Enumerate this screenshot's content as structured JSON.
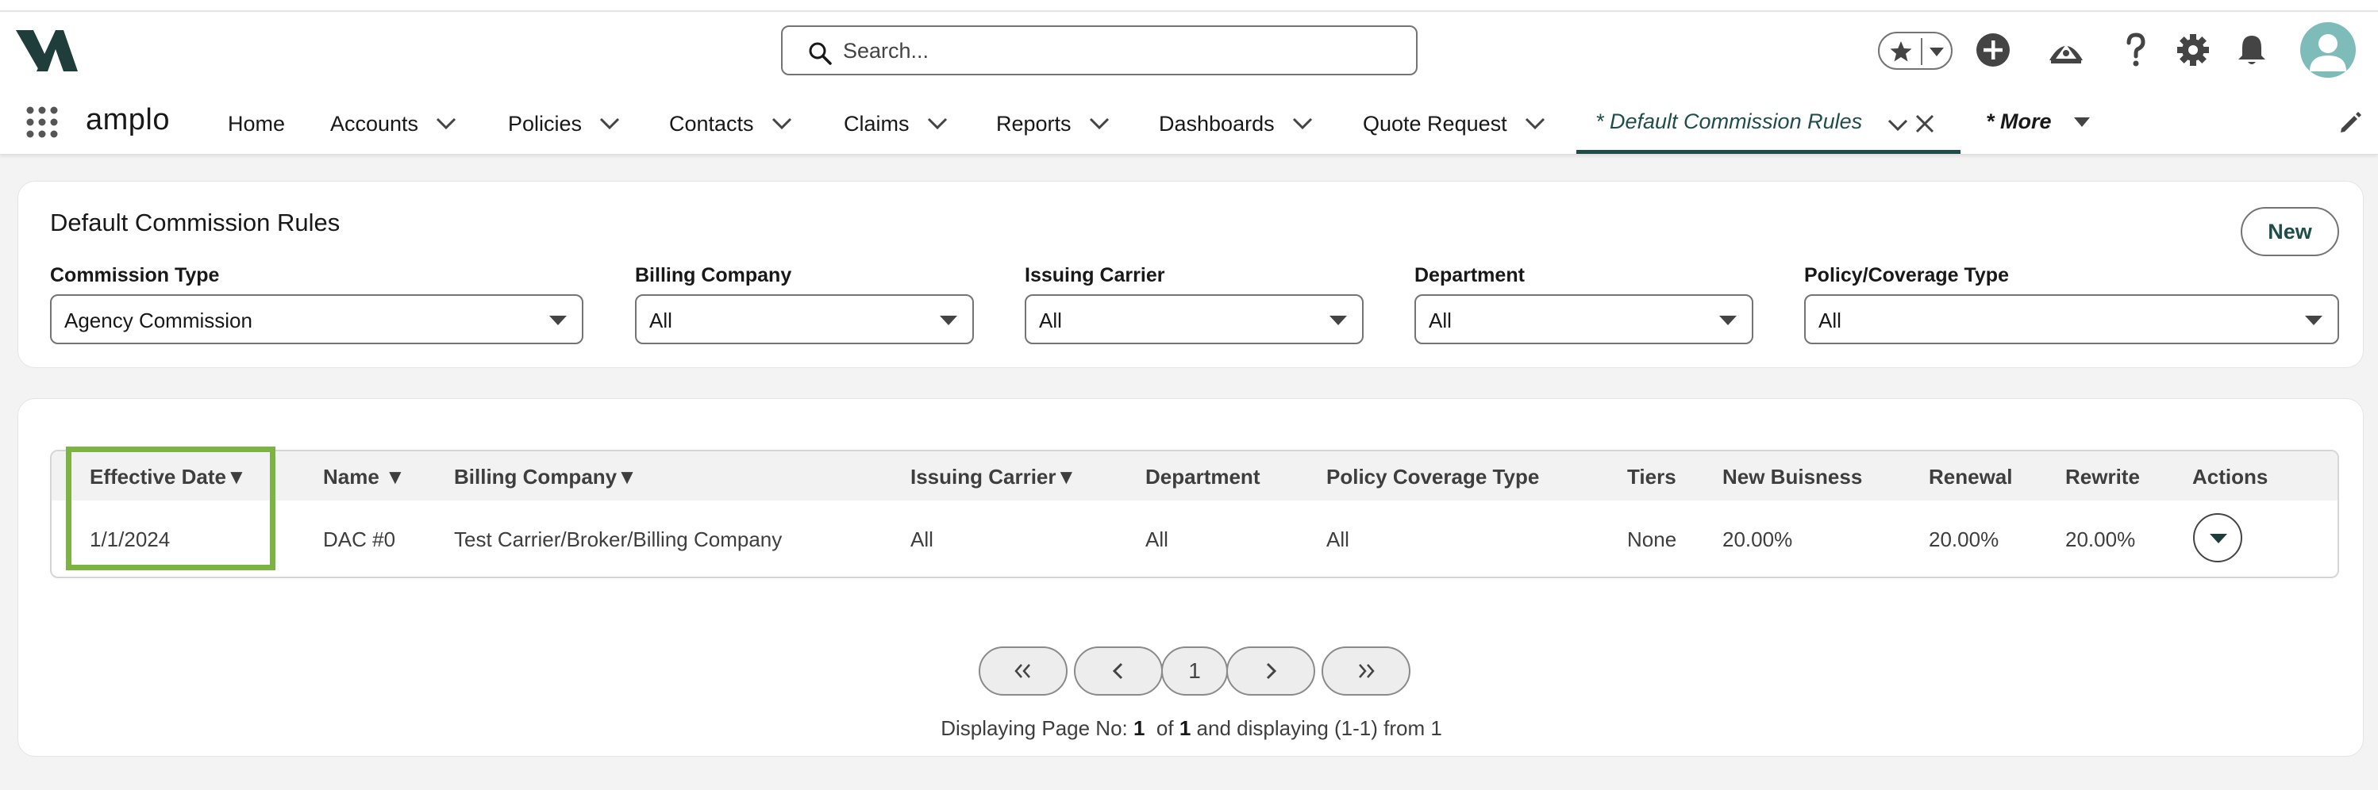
{
  "header": {
    "search_placeholder": "Search...",
    "app_name": "amplo"
  },
  "nav": {
    "items": [
      {
        "label": "Home"
      },
      {
        "label": "Accounts"
      },
      {
        "label": "Policies"
      },
      {
        "label": "Contacts"
      },
      {
        "label": "Claims"
      },
      {
        "label": "Reports"
      },
      {
        "label": "Dashboards"
      },
      {
        "label": "Quote Request"
      }
    ],
    "active_tab": "* Default Commission Rules",
    "more_label": "* More"
  },
  "filters": {
    "title": "Default Commission Rules",
    "new_label": "New",
    "commission_type": {
      "label": "Commission Type",
      "value": "Agency Commission"
    },
    "billing_company": {
      "label": "Billing Company",
      "value": "All"
    },
    "issuing_carrier": {
      "label": "Issuing Carrier",
      "value": "All"
    },
    "department": {
      "label": "Department",
      "value": "All"
    },
    "policy_coverage_type": {
      "label": "Policy/Coverage Type",
      "value": "All"
    }
  },
  "table": {
    "columns": [
      "Effective Date▼",
      "Name ▼",
      "Billing Company▼",
      "Issuing Carrier▼",
      "Department",
      "Policy Coverage Type",
      "Tiers",
      "New Buisness",
      "Renewal",
      "Rewrite",
      "Actions"
    ],
    "rows": [
      {
        "effective_date": "1/1/2024",
        "name": "DAC #0",
        "billing_company": "Test Carrier/Broker/Billing Company",
        "issuing_carrier": "All",
        "department": "All",
        "policy_coverage_type": "All",
        "tiers": "None",
        "new_business": "20.00%",
        "renewal": "20.00%",
        "rewrite": "20.00%"
      }
    ]
  },
  "pagination": {
    "current_page": "1",
    "info_prefix": "Displaying Page No:",
    "page": "1",
    "of_label": "of",
    "total_pages": "1",
    "info_suffix": "and displaying (1-1) from 1"
  },
  "colors": {
    "brand": "#1f4e4a",
    "highlight": "#7cb342",
    "avatar": "#7dbcb8"
  }
}
